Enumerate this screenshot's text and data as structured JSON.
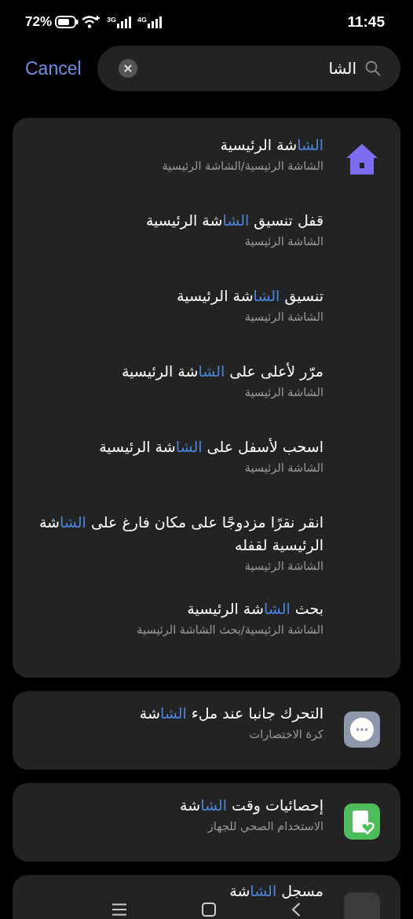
{
  "status_bar": {
    "battery_text": "72%",
    "sim1_network": "3G",
    "sim2_network": "4G",
    "time": "11:45"
  },
  "search": {
    "cancel": "Cancel",
    "value": "الشا"
  },
  "groups": [
    {
      "kind": "home",
      "items": [
        {
          "match": "الشا",
          "after": "شة الرئيسية",
          "subtitle": "الشاشة الرئيسية/الشاشة الرئيسية"
        },
        {
          "before": "قفل تنسيق ",
          "match": "الشا",
          "after": "شة الرئيسية",
          "subtitle": "الشاشة الرئيسية"
        },
        {
          "before": "تنسيق ",
          "match": "الشا",
          "after": "شة الرئيسية",
          "subtitle": "الشاشة الرئيسية"
        },
        {
          "before": "مرّر لأعلى على ",
          "match": "الشا",
          "after": "شة الرئيسية",
          "subtitle": "الشاشة الرئيسية"
        },
        {
          "before": "اسحب لأسفل على ",
          "match": "الشا",
          "after": "شة الرئيسية",
          "subtitle": "الشاشة الرئيسية"
        },
        {
          "before": "انقر نقرًا مزدوجًا على مكان فارغ على ",
          "match": "الشا",
          "after": "شة الرئيسية لقفله",
          "subtitle": "الشاشة الرئيسية"
        },
        {
          "before": "بحث ",
          "match": "الشا",
          "after": "شة الرئيسية",
          "subtitle": "الشاشة الرئيسية/بحث الشاشة الرئيسية"
        }
      ]
    },
    {
      "kind": "assistive-ball",
      "items": [
        {
          "before": "التحرك جانبا عند ملء ",
          "match": "الشا",
          "after": "شة",
          "subtitle": "كرة الاختصارات"
        }
      ]
    },
    {
      "kind": "screen-time",
      "items": [
        {
          "before": "إحصائيات وقت ",
          "match": "الشا",
          "after": "شة",
          "subtitle": "الاستخدام الصحي للجهاز"
        }
      ]
    },
    {
      "kind": "recorder",
      "items": [
        {
          "before": "مسجل ",
          "match": "الشا",
          "after": "شة"
        }
      ]
    }
  ]
}
